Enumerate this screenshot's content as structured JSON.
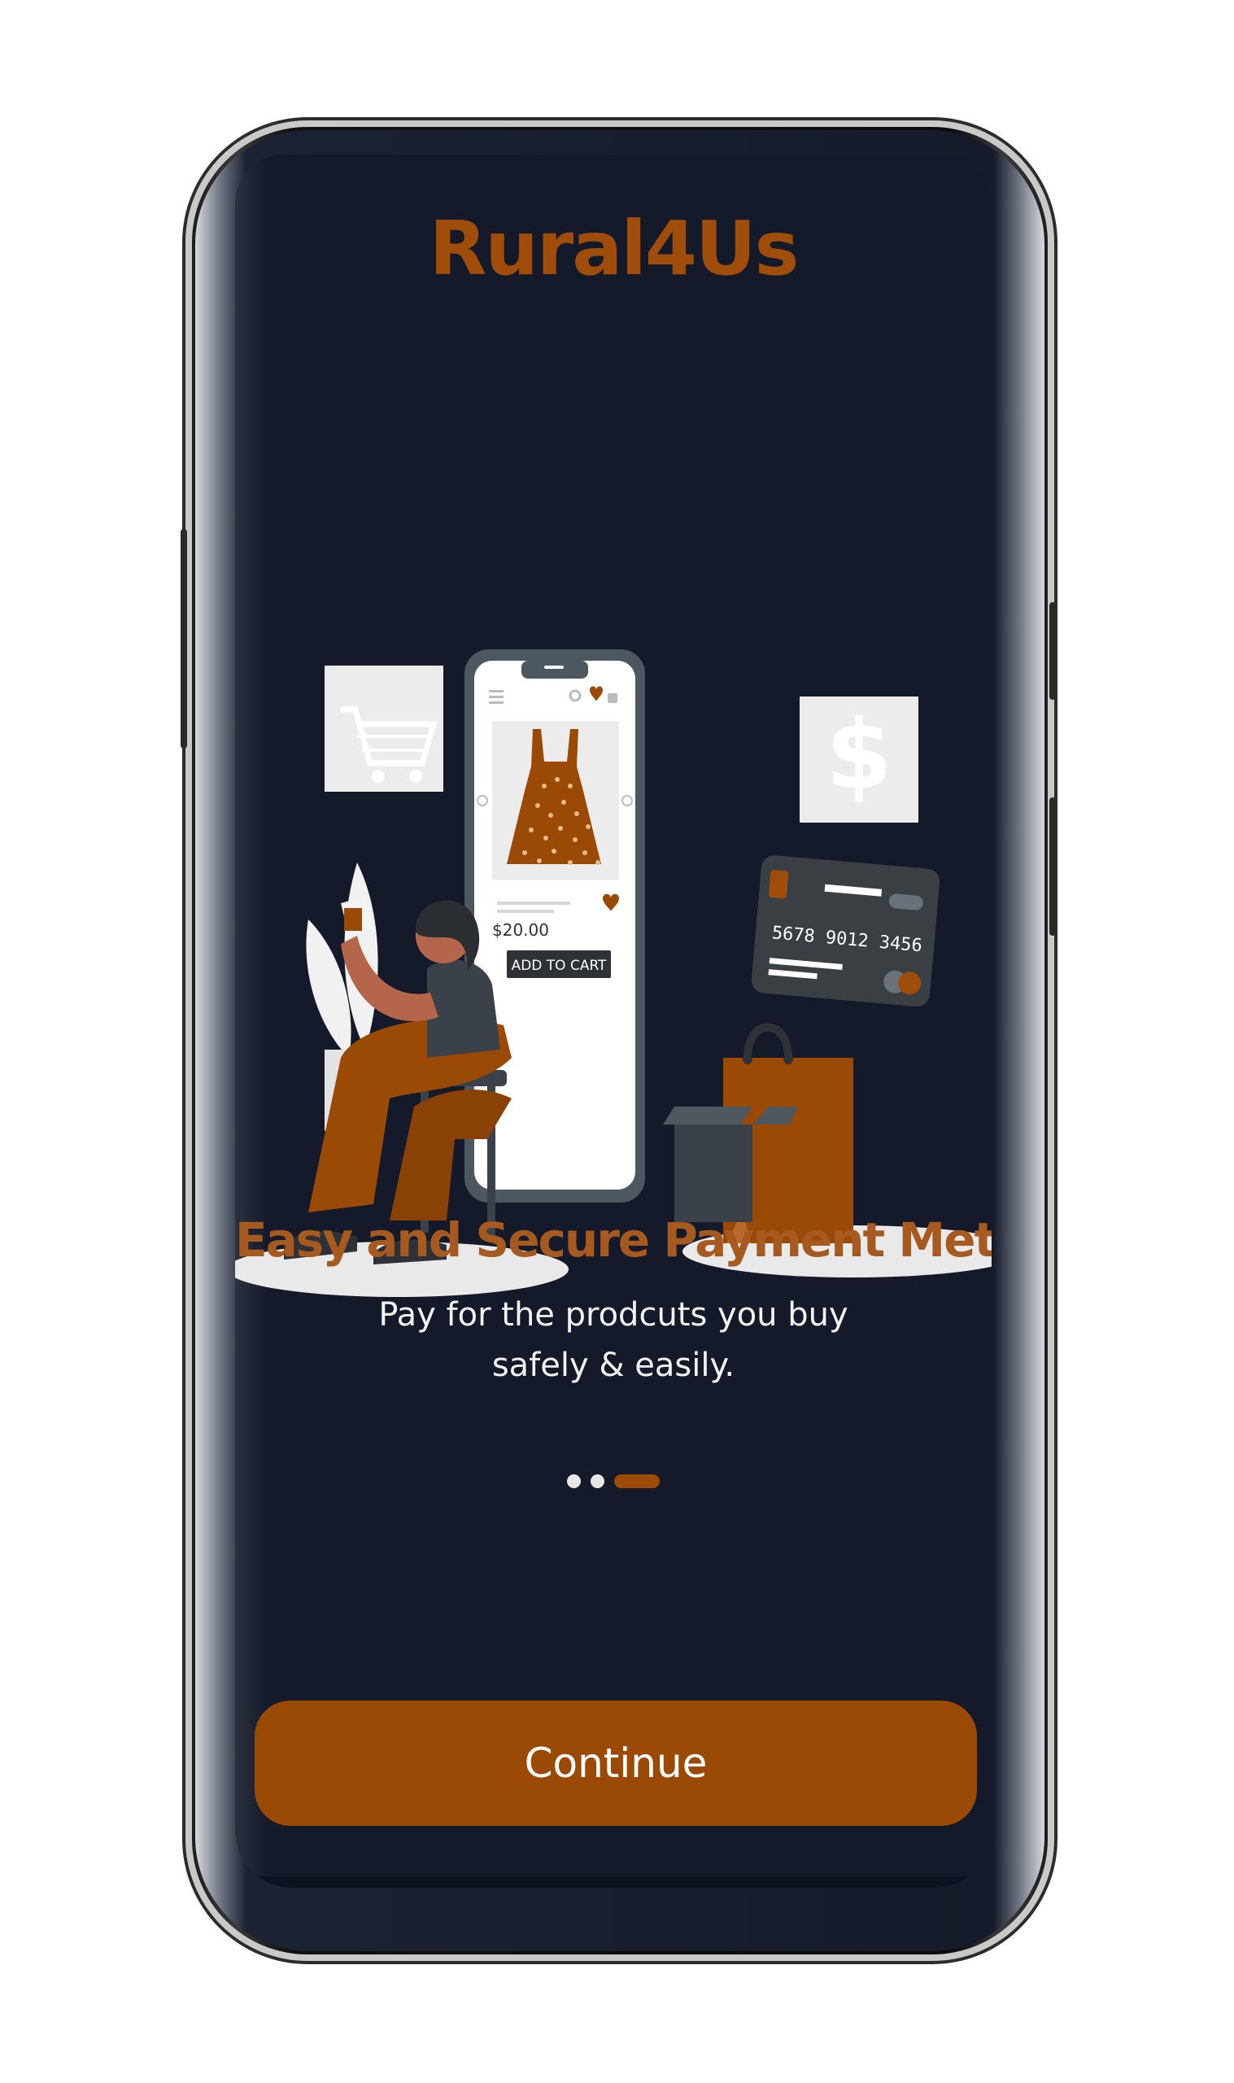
{
  "app": {
    "title": "Rural4Us"
  },
  "illustration": {
    "description_icon": "shopping-payment-illustration-icon",
    "price_label": "$20.00",
    "add_to_cart_label": "ADD TO CART",
    "card_number": "5678  9012  3456",
    "cart_icon": "shopping-cart-icon",
    "dollar_icon": "dollar-sign-icon"
  },
  "onboarding": {
    "headline": "Easy and Secure Payment Method",
    "subtext_line1": "Pay for the prodcuts you buy",
    "subtext_line2": "safely & easily.",
    "page_count": 3,
    "active_page": 3
  },
  "actions": {
    "continue_label": "Continue"
  },
  "colors": {
    "screen_bg": "#141a2a",
    "accent": "#9b4a06",
    "title": "#a04d0c",
    "headline": "#a65a1f",
    "text": "#f3f3f3"
  }
}
